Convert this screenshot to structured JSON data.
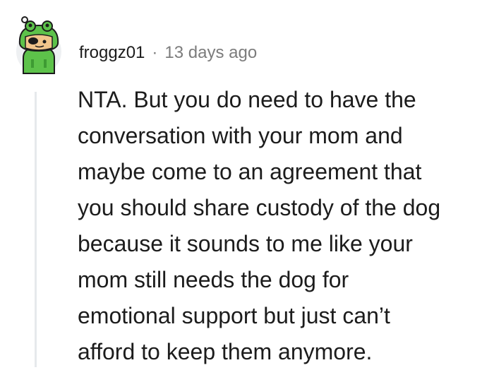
{
  "comment": {
    "author": "froggz01",
    "separator": "·",
    "timestamp": "13 days ago",
    "avatar_icon": "frog-hood-avatar-icon",
    "body_lines": [
      "NTA. But you do need to have the",
      "conversation with your mom and",
      "maybe come to an agreement that",
      "you should share custody of the dog",
      "because it sounds to me like your",
      "mom still needs the dog for",
      "emotional support but just can’t",
      "afford to keep them anymore."
    ]
  },
  "colors": {
    "text": "#1c1c1c",
    "meta": "#7c7c7c",
    "thread_line": "#e6e9ec",
    "avatar_bg": "#eef0f2",
    "frog_green": "#5dc24a"
  }
}
